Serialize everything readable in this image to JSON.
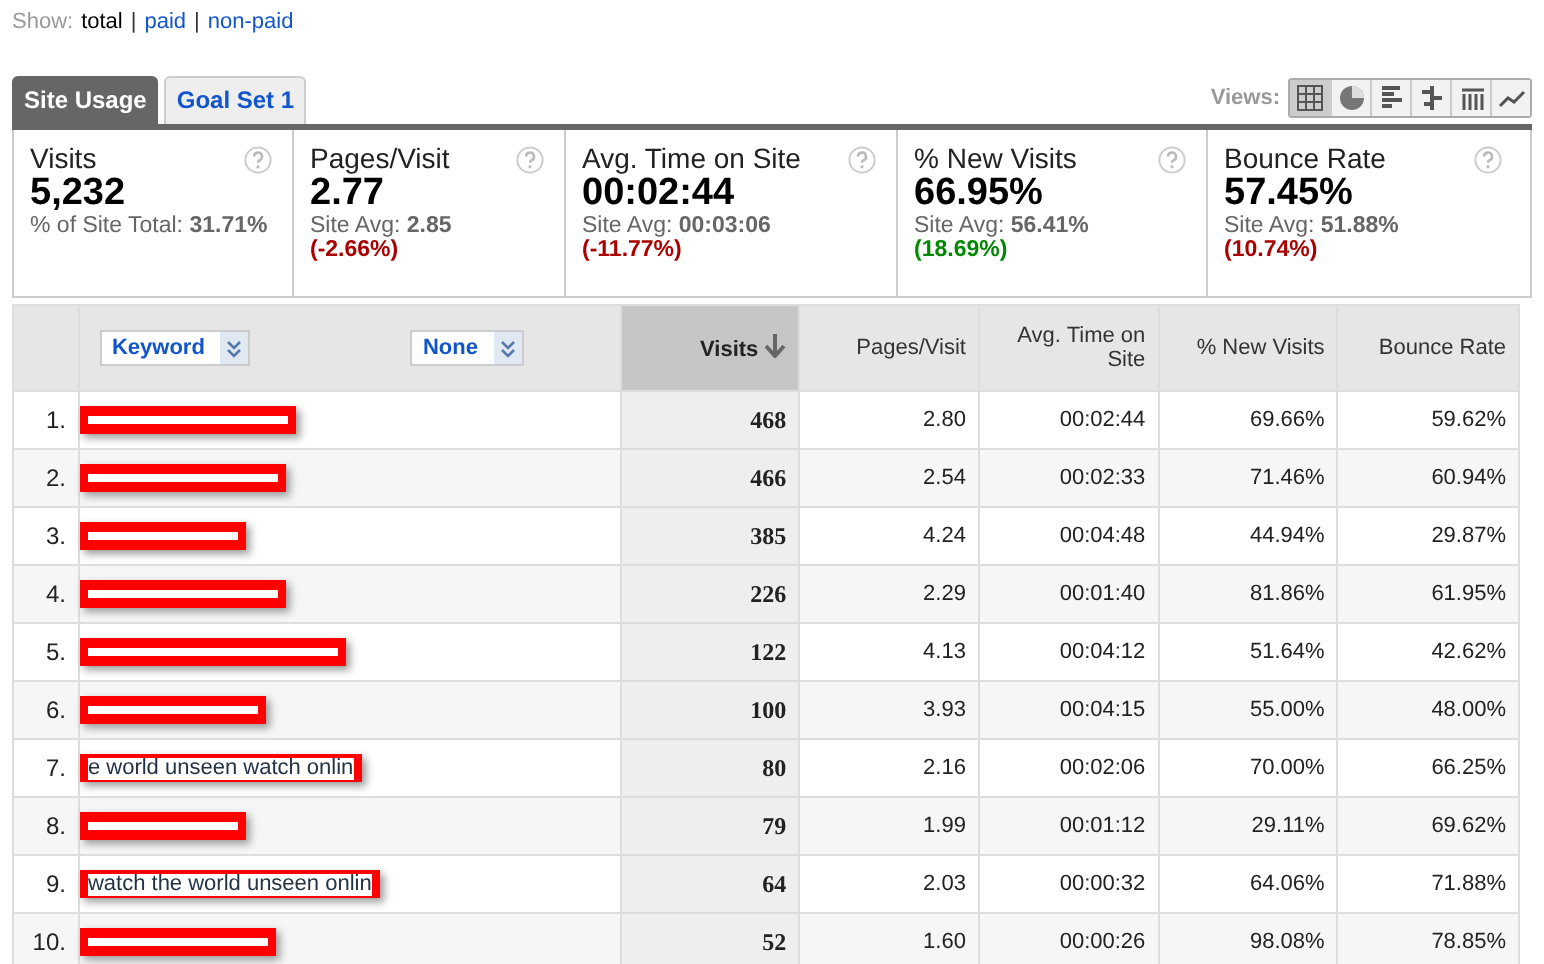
{
  "show": {
    "label": "Show:",
    "separator": "|",
    "options": [
      {
        "label": "total",
        "selected": true
      },
      {
        "label": "paid",
        "selected": false
      },
      {
        "label": "non-paid",
        "selected": false
      }
    ]
  },
  "tabs": [
    {
      "label": "Site Usage",
      "selected": true
    },
    {
      "label": "Goal Set 1",
      "selected": false
    }
  ],
  "views": {
    "label": "Views:",
    "buttons": [
      {
        "kind": "table",
        "selected": true
      },
      {
        "kind": "pie",
        "selected": false
      },
      {
        "kind": "bars",
        "selected": false
      },
      {
        "kind": "compare",
        "selected": false
      },
      {
        "kind": "pivot",
        "selected": false
      },
      {
        "kind": "trend",
        "selected": false
      }
    ]
  },
  "metrics": [
    {
      "title": "Visits",
      "value": "5,232",
      "note": "% of Site Total:",
      "avg": "31.71%"
    },
    {
      "title": "Pages/Visit",
      "value": "2.77",
      "note": "Site Avg:",
      "avg": "2.85",
      "change": "(-2.66%)",
      "color": "#aa0000"
    },
    {
      "title": "Avg. Time on Site",
      "value": "00:02:44",
      "note": "Site Avg:",
      "avg": "00:03:06",
      "change": "(-11.77%)",
      "color": "#aa0000"
    },
    {
      "title": "% New Visits",
      "value": "66.95%",
      "note": "Site Avg:",
      "avg": "56.41%",
      "change": "(18.69%)",
      "color": "#008800"
    },
    {
      "title": "Bounce Rate",
      "value": "57.45%",
      "note": "Site Avg:",
      "avg": "51.88%",
      "change": "(10.74%)",
      "color": "#aa0000"
    }
  ],
  "table": {
    "dimension": "Keyword",
    "secondary": "None",
    "columns": [
      "Visits",
      "Pages/Visit",
      "Avg. Time on Site",
      "% New Visits",
      "Bounce Rate"
    ],
    "rows": [
      {
        "rank": "1.",
        "values": [
          "468",
          "2.80",
          "00:02:44",
          "69.66%",
          "59.62%"
        ]
      },
      {
        "rank": "2.",
        "values": [
          "466",
          "2.54",
          "00:02:33",
          "71.46%",
          "60.94%"
        ]
      },
      {
        "rank": "3.",
        "values": [
          "385",
          "4.24",
          "00:04:48",
          "44.94%",
          "29.87%"
        ]
      },
      {
        "rank": "4.",
        "values": [
          "226",
          "2.29",
          "00:01:40",
          "81.86%",
          "61.95%"
        ]
      },
      {
        "rank": "5.",
        "values": [
          "122",
          "4.13",
          "00:04:12",
          "51.64%",
          "42.62%"
        ]
      },
      {
        "rank": "6.",
        "values": [
          "100",
          "3.93",
          "00:04:15",
          "55.00%",
          "48.00%"
        ]
      },
      {
        "rank": "7.",
        "keyword": "e world unseen watch onlin",
        "values": [
          "80",
          "2.16",
          "00:02:06",
          "70.00%",
          "66.25%"
        ]
      },
      {
        "rank": "8.",
        "values": [
          "79",
          "1.99",
          "00:01:12",
          "29.11%",
          "69.62%"
        ]
      },
      {
        "rank": "9.",
        "keyword": "watch the world unseen onlin",
        "values": [
          "64",
          "2.03",
          "00:00:32",
          "64.06%",
          "71.88%"
        ]
      },
      {
        "rank": "10.",
        "values": [
          "52",
          "1.60",
          "00:00:26",
          "98.08%",
          "78.85%"
        ]
      }
    ]
  }
}
